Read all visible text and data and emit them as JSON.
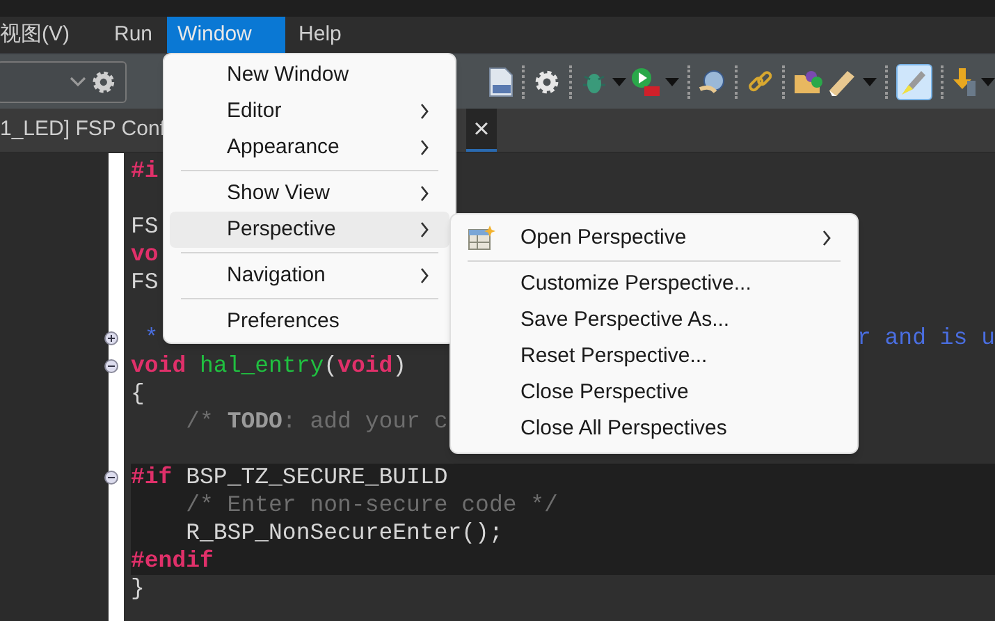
{
  "menu_bar": [
    {
      "label": "视图(V)",
      "selected": false
    },
    {
      "label": "Run",
      "selected": false
    },
    {
      "label": "Window",
      "selected": true
    },
    {
      "label": "Help",
      "selected": false
    }
  ],
  "toolbar": {
    "toggle_button": {
      "selected": true
    }
  },
  "editor_tab": {
    "title": "1_LED] FSP Conf",
    "close": "×"
  },
  "code_lines": [
    {
      "foldable": false,
      "shaded": false,
      "segments": [
        {
          "kind": "directive",
          "text": "#i"
        }
      ]
    },
    {
      "foldable": false,
      "shaded": false
    },
    {
      "foldable": false,
      "shaded": false,
      "segments": [
        {
          "kind": "plain",
          "text": "FS"
        }
      ]
    },
    {
      "foldable": false,
      "shaded": false,
      "segments": [
        {
          "kind": "keyword",
          "text": "vo"
        }
      ]
    },
    {
      "foldable": false,
      "shaded": false,
      "segments": [
        {
          "kind": "plain",
          "text": "FS"
        }
      ]
    },
    {
      "foldable": false,
      "shaded": false
    },
    {
      "foldable": true,
      "expanded": false,
      "shaded": false,
      "segments": [
        {
          "kind": "doc",
          "text": " *"
        }
      ],
      "tail": {
        "kind": "doc",
        "text": "r and is u"
      }
    },
    {
      "foldable": true,
      "expanded": true,
      "shaded": false,
      "segments": [
        {
          "kind": "keyword",
          "text": "void"
        },
        {
          "kind": "function",
          "text": " hal_entry"
        },
        {
          "kind": "plain",
          "text": "("
        },
        {
          "kind": "keyword",
          "text": "void"
        },
        {
          "kind": "plain",
          "text": ")"
        }
      ]
    },
    {
      "foldable": false,
      "shaded": false,
      "segments": [
        {
          "kind": "plain",
          "text": "{"
        }
      ]
    },
    {
      "foldable": false,
      "shaded": false,
      "segments": [
        {
          "kind": "comment",
          "text": "    /* "
        },
        {
          "kind": "todo",
          "text": "TODO"
        },
        {
          "kind": "comment",
          "text": ": add your c"
        }
      ]
    },
    {
      "foldable": false,
      "shaded": false
    },
    {
      "foldable": true,
      "expanded": true,
      "shaded": true,
      "segments": [
        {
          "kind": "directive",
          "text": "#if"
        },
        {
          "kind": "plain",
          "text": " BSP_TZ_SECURE_BUILD"
        }
      ]
    },
    {
      "foldable": false,
      "shaded": true,
      "segments": [
        {
          "kind": "comment",
          "text": "    /* Enter non-secure code */"
        }
      ]
    },
    {
      "foldable": false,
      "shaded": true,
      "segments": [
        {
          "kind": "plain",
          "text": "    R_BSP_NonSecureEnter();"
        }
      ]
    },
    {
      "foldable": false,
      "shaded": true,
      "segments": [
        {
          "kind": "directive",
          "text": "#endif"
        }
      ]
    },
    {
      "foldable": false,
      "shaded": false,
      "segments": [
        {
          "kind": "plain",
          "text": "}"
        }
      ]
    }
  ],
  "window_menu": [
    {
      "kind": "item",
      "label": "New Window",
      "submenu": false,
      "selected": false
    },
    {
      "kind": "item",
      "label": "Editor",
      "submenu": true,
      "selected": false
    },
    {
      "kind": "item",
      "label": "Appearance",
      "submenu": true,
      "selected": false
    },
    {
      "kind": "separator"
    },
    {
      "kind": "item",
      "label": "Show View",
      "submenu": true,
      "selected": false
    },
    {
      "kind": "item",
      "label": "Perspective",
      "submenu": true,
      "selected": true
    },
    {
      "kind": "separator"
    },
    {
      "kind": "item",
      "label": "Navigation",
      "submenu": true,
      "selected": false
    },
    {
      "kind": "separator"
    },
    {
      "kind": "item",
      "label": "Preferences",
      "submenu": false,
      "selected": false
    }
  ],
  "perspective_submenu": [
    {
      "kind": "item",
      "label": "Open Perspective",
      "submenu": true,
      "icon": true
    },
    {
      "kind": "separator"
    },
    {
      "kind": "item",
      "label": "Customize Perspective...",
      "submenu": false,
      "icon": false
    },
    {
      "kind": "item",
      "label": "Save Perspective As...",
      "submenu": false,
      "icon": false
    },
    {
      "kind": "item",
      "label": "Reset Perspective...",
      "submenu": false,
      "icon": false
    },
    {
      "kind": "item",
      "label": "Close Perspective",
      "submenu": false,
      "icon": false
    },
    {
      "kind": "item",
      "label": "Close All Perspectives",
      "submenu": false,
      "icon": false
    }
  ]
}
